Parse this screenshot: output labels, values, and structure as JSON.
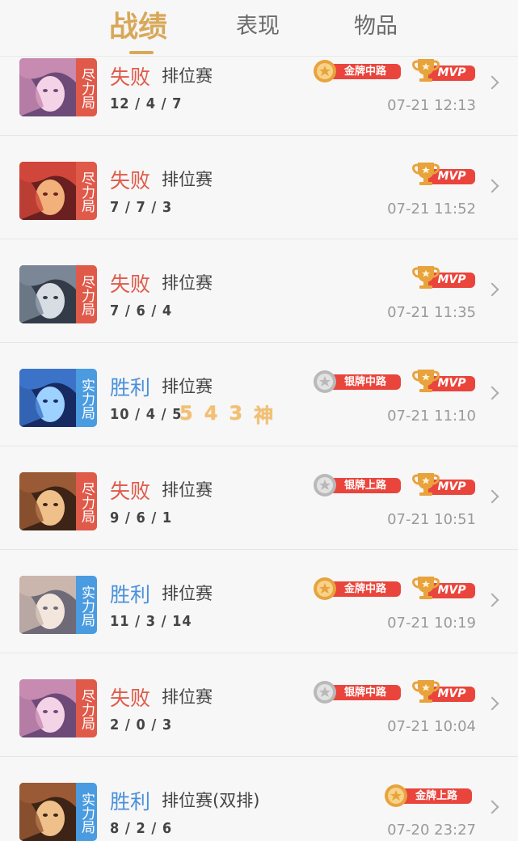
{
  "tabs": [
    {
      "label": "战绩",
      "active": true
    },
    {
      "label": "表现",
      "active": false
    },
    {
      "label": "物品",
      "active": false
    }
  ],
  "colors": {
    "accent": "#d8a85a",
    "lose": "#e05a4a",
    "win": "#4a90d9",
    "badge_red": "#e9453c",
    "gold_medal": "#e8a33c",
    "silver_medal": "#b9b9b9"
  },
  "matches": [
    {
      "result": "失败",
      "outcome": "lose",
      "mode": "尽力局",
      "type": "排位赛",
      "kda": "12 / 4 / 7",
      "streak": [],
      "badge": "金牌中路",
      "medal": "gold",
      "mvp": "MVP",
      "time": "07-21 12:13",
      "hero_hue": "pink"
    },
    {
      "result": "失败",
      "outcome": "lose",
      "mode": "尽力局",
      "type": "排位赛",
      "kda": "7 / 7 / 3",
      "streak": [],
      "badge": "",
      "medal": "",
      "mvp": "MVP",
      "time": "07-21 11:52",
      "hero_hue": "red"
    },
    {
      "result": "失败",
      "outcome": "lose",
      "mode": "尽力局",
      "type": "排位赛",
      "kda": "7 / 6 / 4",
      "streak": [],
      "badge": "",
      "medal": "",
      "mvp": "MVP",
      "time": "07-21 11:35",
      "hero_hue": "gray"
    },
    {
      "result": "胜利",
      "outcome": "win",
      "mode": "实力局",
      "type": "排位赛",
      "kda": "10 / 4 / 5",
      "streak": [
        "5",
        "4",
        "3",
        "神"
      ],
      "badge": "银牌中路",
      "medal": "silver",
      "mvp": "MVP",
      "time": "07-21 11:10",
      "hero_hue": "blue"
    },
    {
      "result": "失败",
      "outcome": "lose",
      "mode": "尽力局",
      "type": "排位赛",
      "kda": "9 / 6 / 1",
      "streak": [],
      "badge": "银牌上路",
      "medal": "silver",
      "mvp": "MVP",
      "time": "07-21 10:51",
      "hero_hue": "brown"
    },
    {
      "result": "胜利",
      "outcome": "win",
      "mode": "实力局",
      "type": "排位赛",
      "kda": "11 / 3 / 14",
      "streak": [],
      "badge": "金牌中路",
      "medal": "gold",
      "mvp": "MVP",
      "time": "07-21 10:19",
      "hero_hue": "light"
    },
    {
      "result": "失败",
      "outcome": "lose",
      "mode": "尽力局",
      "type": "排位赛",
      "kda": "2 / 0 / 3",
      "streak": [],
      "badge": "银牌中路",
      "medal": "silver",
      "mvp": "MVP",
      "time": "07-21 10:04",
      "hero_hue": "pink"
    },
    {
      "result": "胜利",
      "outcome": "win",
      "mode": "实力局",
      "type": "排位赛(双排)",
      "kda": "8 / 2 / 6",
      "streak": [],
      "badge": "金牌上路",
      "medal": "gold",
      "mvp": "",
      "time": "07-20 23:27",
      "hero_hue": "brown"
    }
  ]
}
